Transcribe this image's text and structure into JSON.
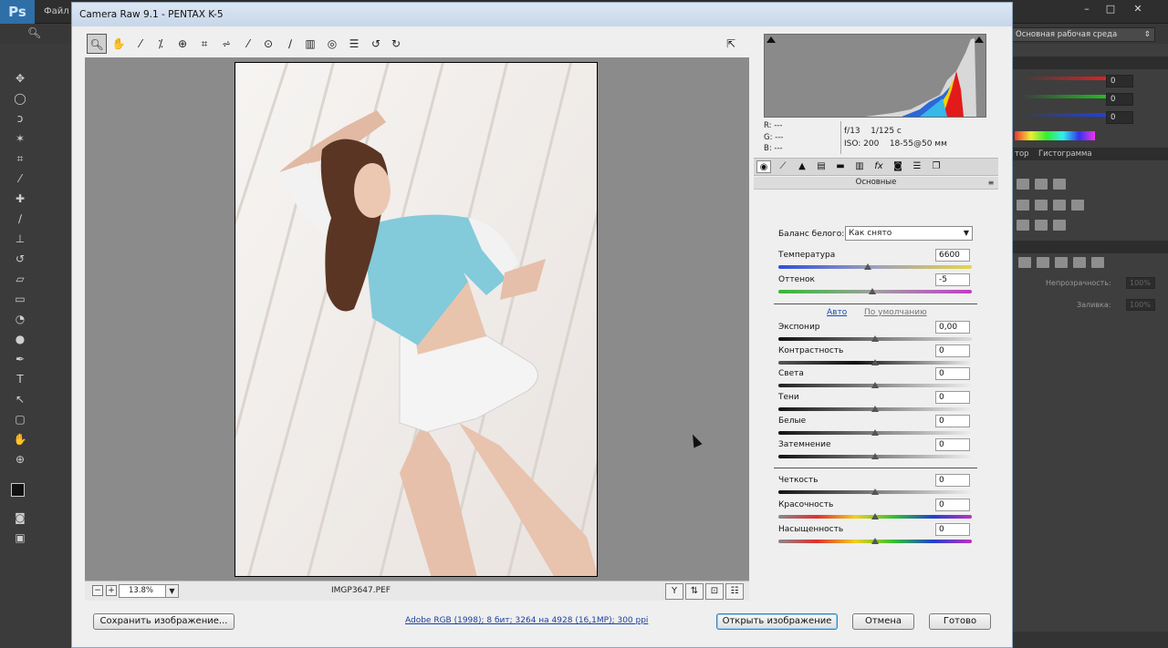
{
  "ps": {
    "logo": "Ps",
    "menu_file": "Файл",
    "workspace": "Основная рабочая среда",
    "color_values": [
      "0",
      "0",
      "0"
    ],
    "tab_navigator": "тор",
    "tab_histogram": "Гистограмма",
    "opacity_label": "Непрозрачность:",
    "opacity_value": "100%",
    "fill_label": "Заливка:",
    "fill_value": "100%"
  },
  "dialog": {
    "title": "Camera Raw 9.1  -  PENTAX K-5",
    "zoom": "13.8%",
    "filename": "IMGP3647.PEF",
    "camera": {
      "r": "R:   ---",
      "g": "G:   ---",
      "b": "B:   ---",
      "aperture": "f/13",
      "shutter": "1/125 с",
      "iso": "ISO: 200",
      "lens": "18-55@50 мм"
    },
    "panel_title": "Основные",
    "white_balance": {
      "label": "Баланс белого:",
      "value": "Как снято"
    },
    "temperature": {
      "label": "Температура",
      "value": "6600"
    },
    "tint": {
      "label": "Оттенок",
      "value": "-5"
    },
    "auto": "Авто",
    "default": "По умолчанию",
    "sliders": [
      {
        "label": "Экспонир",
        "value": "0,00"
      },
      {
        "label": "Контрастность",
        "value": "0"
      },
      {
        "label": "Света",
        "value": "0"
      },
      {
        "label": "Тени",
        "value": "0"
      },
      {
        "label": "Белые",
        "value": "0"
      },
      {
        "label": "Затемнение",
        "value": "0"
      }
    ],
    "presence": [
      {
        "label": "Четкость",
        "value": "0"
      },
      {
        "label": "Красочность",
        "value": "0"
      },
      {
        "label": "Насыщенность",
        "value": "0"
      }
    ],
    "save_button": "Сохранить изображение...",
    "workflow": "Adobe RGB (1998); 8 бит; 3264 на 4928 (16,1MP); 300 ppi",
    "open_button": "Открыть изображение",
    "cancel_button": "Отмена",
    "done_button": "Готово"
  }
}
